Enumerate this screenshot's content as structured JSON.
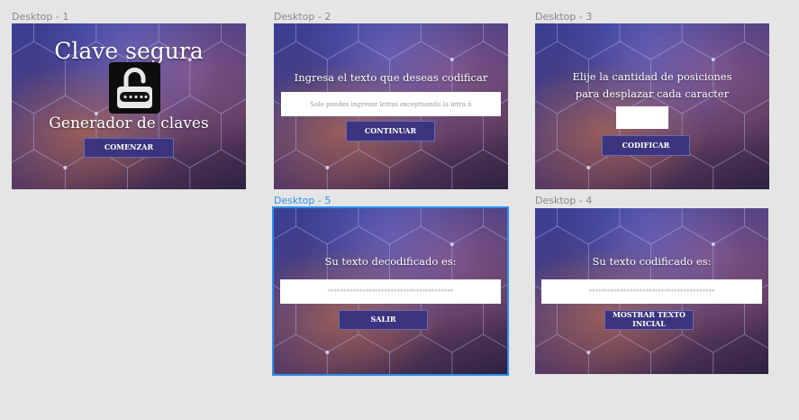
{
  "frames": {
    "d1": {
      "label": "Desktop - 1",
      "title": "Clave segura",
      "subtitle": "Generador de claves",
      "button": "COMENZAR"
    },
    "d2": {
      "label": "Desktop - 2",
      "heading": "Ingresa el texto que deseas codificar",
      "input_placeholder": "Solo puedes ingresar letras exceptuando la letra ñ",
      "button": "CONTINUAR"
    },
    "d3": {
      "label": "Desktop - 3",
      "heading_line1": "Elije la cantidad de posiciones",
      "heading_line2": "para desplazar cada caracter",
      "input_value": "",
      "button": "CODIFICAR"
    },
    "d5": {
      "label": "Desktop - 5",
      "heading": "Su texto decodificado es:",
      "output_value": "****************************************",
      "button": "SALIR"
    },
    "d4": {
      "label": "Desktop - 4",
      "heading": "Su texto codificado es:",
      "output_value": "****************************************",
      "button_line1": "MOSTRAR TEXTO",
      "button_line2": "INICIAL"
    }
  },
  "colors": {
    "canvas": "#e5e5e5",
    "selection": "#2c8ff0",
    "button_fill": "#3b3580",
    "frame_top": "#3a3f93",
    "frame_bottom": "#2e2140"
  }
}
